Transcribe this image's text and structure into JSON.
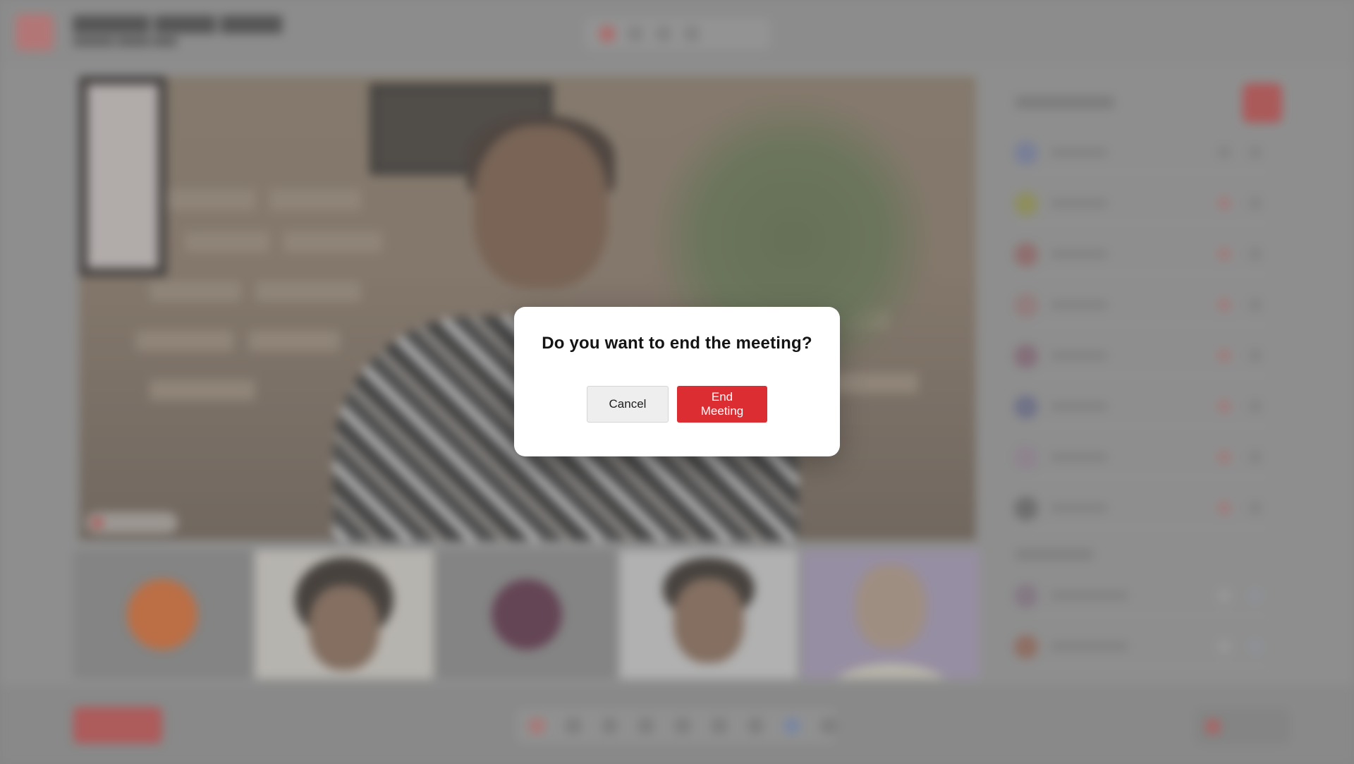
{
  "dialog": {
    "title": "Do you want to end the meeting?",
    "cancel_label": "Cancel",
    "confirm_label": "End Meeting"
  },
  "colors": {
    "accent": "#dc2d33",
    "dialog_bg": "#ffffff",
    "overlay": "#8f8f8f"
  },
  "background_icons": [
    "app-logo-icon",
    "record-icon",
    "mic-icon",
    "camera-icon",
    "screen-share-icon",
    "chat-icon",
    "participants-icon"
  ]
}
